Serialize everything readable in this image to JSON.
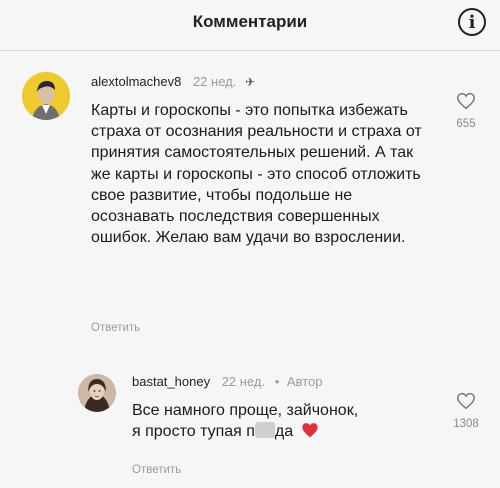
{
  "header": {
    "title": "Комментарии",
    "info_icon": "info-icon"
  },
  "comments": [
    {
      "username": "alextolmachev8",
      "time": "22 нед.",
      "pinned_icon": "pin-icon",
      "text": "Карты и гороскопы - это попытка избежать страха от осознания реальности и страха от принятия самостоятельных решений. А так же карты и гороскопы - это способ отложить свое развитие, чтобы подольше не осознавать последствия совершенных ошибок. Желаю вам удачи во взрослении.",
      "reply_label": "Ответить",
      "like_count": "655"
    },
    {
      "username": "bastat_honey",
      "time": "22 нед.",
      "separator": "•",
      "author_badge": "Автор",
      "text_line1": "Все намного проще, зайчонок,",
      "text_line2_a": "я просто тупая п",
      "text_line2_b": "да",
      "emoji": "red-heart-emoji",
      "reply_label": "Ответить",
      "like_count": "1308"
    }
  ],
  "colors": {
    "background": "#f6f6f6",
    "muted": "#9a9a9a",
    "heart": "#e0303a"
  }
}
